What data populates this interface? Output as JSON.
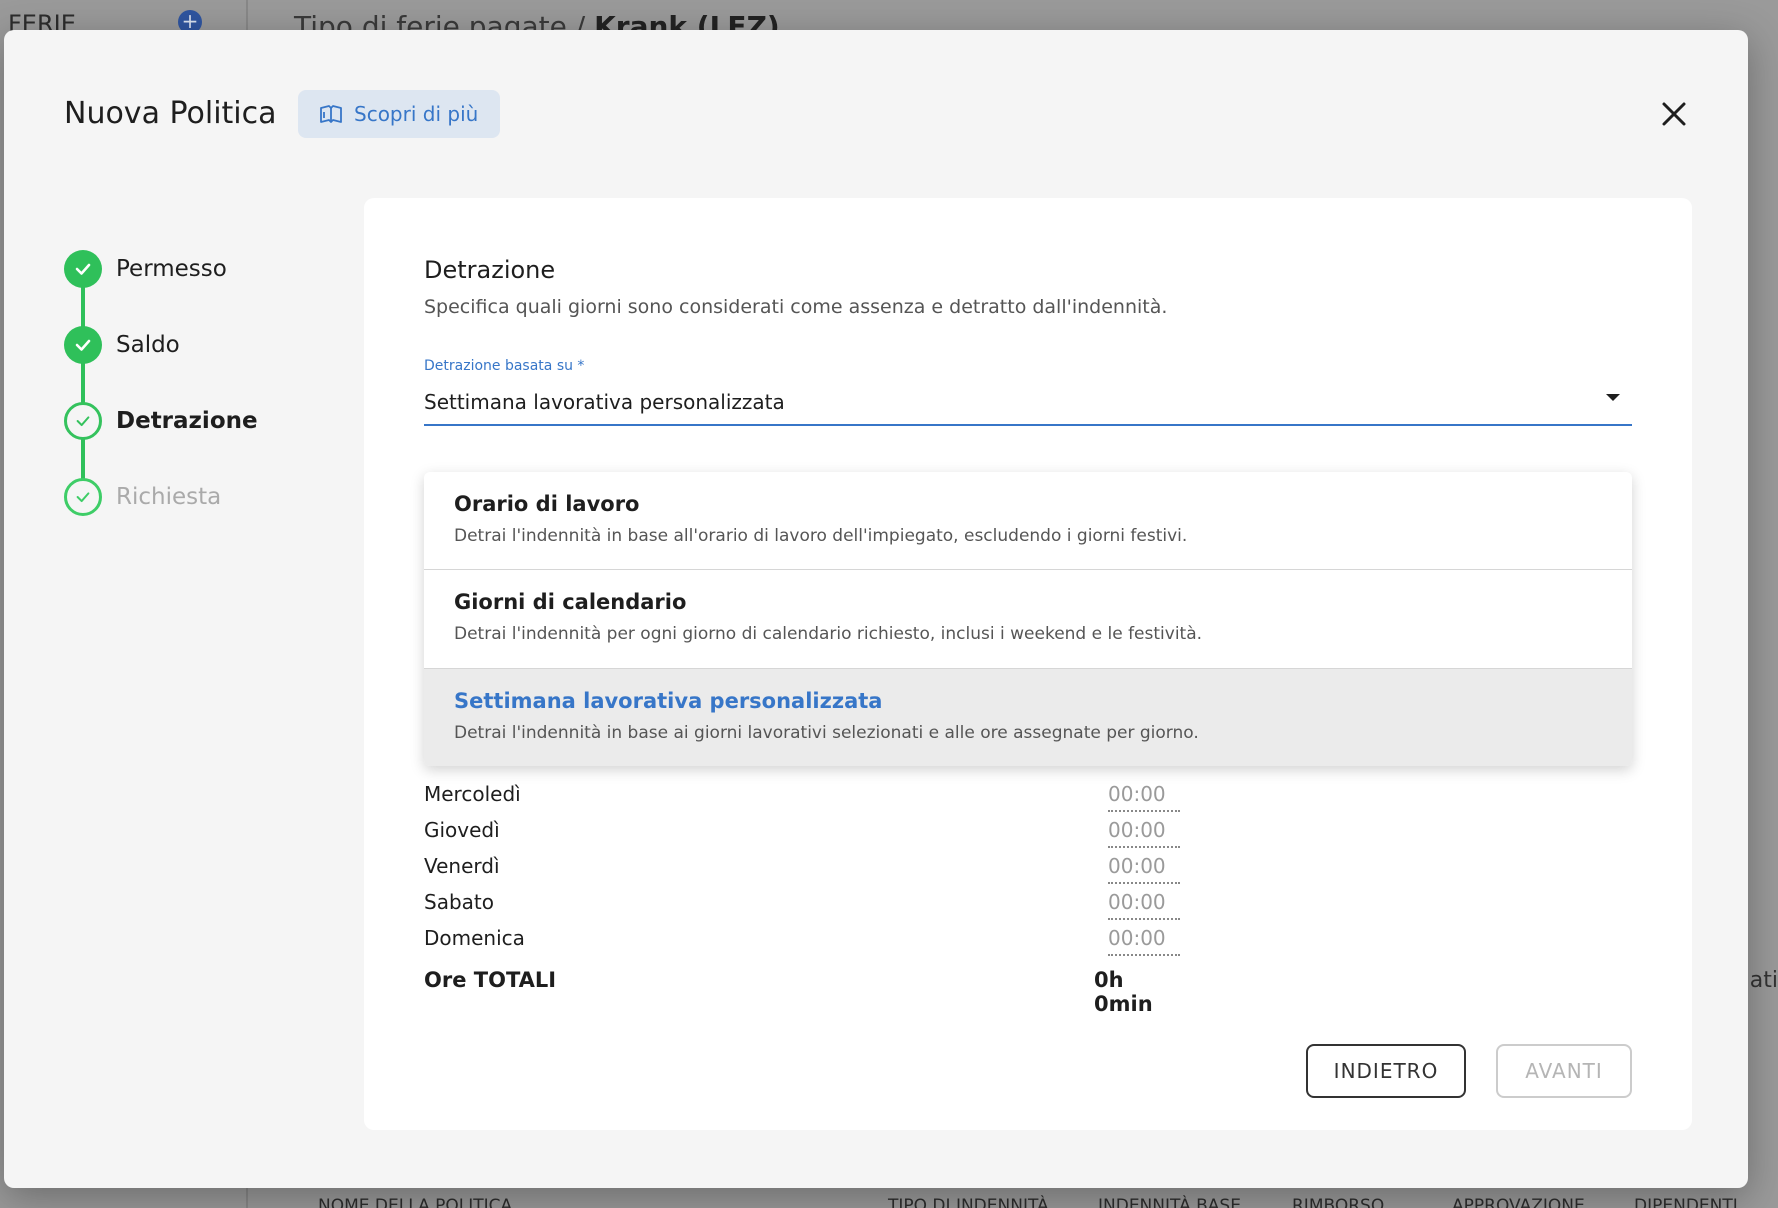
{
  "background": {
    "sidebar_label": "FERIE",
    "title_prefix": "Tipo di ferie pagate / ",
    "title_bold": "Krank (LFZ)",
    "right_fragment": "ati",
    "table_headers": [
      "NOME DELLA POLITICA",
      "TIPO DI INDENNITÀ",
      "INDENNITÀ BASE",
      "RIMBORSO",
      "APPROVAZIONE",
      "DIPENDENTI"
    ]
  },
  "modal": {
    "title": "Nuova Politica",
    "learn_more_label": "Scopri di più"
  },
  "stepper": {
    "steps": [
      {
        "label": "Permesso",
        "state": "done"
      },
      {
        "label": "Saldo",
        "state": "done"
      },
      {
        "label": "Detrazione",
        "state": "current"
      },
      {
        "label": "Richiesta",
        "state": "upcoming"
      }
    ]
  },
  "section": {
    "title": "Detrazione",
    "description": "Specifica quali giorni sono considerati come assenza e detratto dall'indennità.",
    "field_label": "Detrazione basata su *",
    "selected_value": "Settimana lavorativa personalizzata"
  },
  "dropdown": {
    "options": [
      {
        "title": "Orario di lavoro",
        "description": "Detrai l'indennità in base all'orario di lavoro dell'impiegato, escludendo i giorni festivi."
      },
      {
        "title": "Giorni di calendario",
        "description": "Detrai l'indennità per ogni giorno di calendario richiesto, inclusi i weekend e le festività."
      },
      {
        "title": "Settimana lavorativa personalizzata",
        "description": "Detrai l'indennità in base ai giorni lavorativi selezionati e alle ore assegnate per giorno."
      }
    ],
    "selected_index": 2
  },
  "days": [
    {
      "name": "Mercoledì",
      "time": "00:00"
    },
    {
      "name": "Giovedì",
      "time": "00:00"
    },
    {
      "name": "Venerdì",
      "time": "00:00"
    },
    {
      "name": "Sabato",
      "time": "00:00"
    },
    {
      "name": "Domenica",
      "time": "00:00"
    }
  ],
  "total": {
    "label": "Ore TOTALI",
    "value": "0h 0min"
  },
  "buttons": {
    "back": "INDIETRO",
    "next": "AVANTI"
  },
  "colors": {
    "accent": "#3776c8",
    "success": "#2fc05a"
  }
}
